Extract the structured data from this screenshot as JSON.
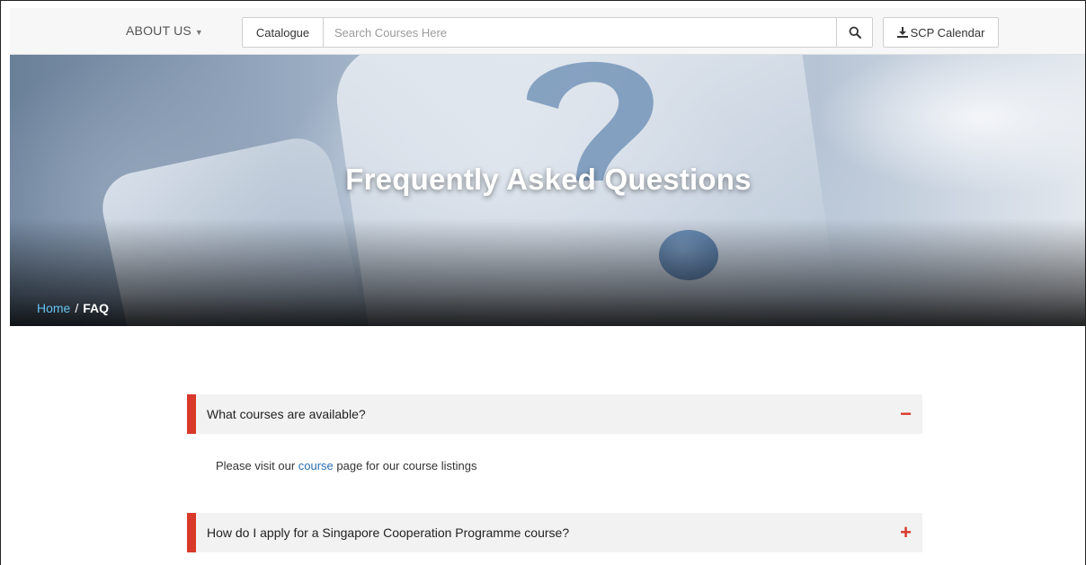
{
  "nav": {
    "about_label": "ABOUT US",
    "catalogue_label": "Catalogue",
    "search_placeholder": "Search Courses Here",
    "calendar_label": "SCP Calendar"
  },
  "hero": {
    "title": "Frequently Asked Questions"
  },
  "breadcrumb": {
    "home": "Home",
    "separator": "/",
    "current": "FAQ"
  },
  "faq": {
    "items": [
      {
        "question": "What courses are available?",
        "toggle": "−",
        "expanded": true,
        "answer_prefix": "Please visit our ",
        "answer_link": "course",
        "answer_suffix": " page for our course listings"
      },
      {
        "question": "How do I apply for a Singapore Cooperation Programme course?",
        "toggle": "+",
        "expanded": false
      }
    ]
  },
  "colors": {
    "accent_red": "#d9392b",
    "link_blue": "#2a6fb1",
    "breadcrumb_link": "#66c1f0"
  }
}
